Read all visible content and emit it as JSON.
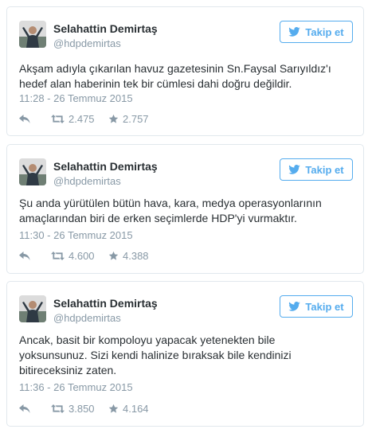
{
  "tweets": [
    {
      "name": "Selahattin Demirtaş",
      "handle": "@hdpdemirtas",
      "follow_label": "Takip et",
      "text": "Akşam adıyla çıkarılan havuz gazetesinin Sn.Faysal Sarıyıldız'ı\nhedef alan haberinin tek bir cümlesi dahi doğru değildir.",
      "timestamp": "11:28 - 26 Temmuz 2015",
      "retweets": "2.475",
      "favorites": "2.757"
    },
    {
      "name": "Selahattin Demirtaş",
      "handle": "@hdpdemirtas",
      "follow_label": "Takip et",
      "text": "Şu anda yürütülen bütün hava, kara, medya operasyonlarının\namaçlarından biri de erken seçimlerde HDP'yi vurmaktır.",
      "timestamp": "11:30 - 26 Temmuz 2015",
      "retweets": "4.600",
      "favorites": "4.388"
    },
    {
      "name": "Selahattin Demirtaş",
      "handle": "@hdpdemirtas",
      "follow_label": "Takip et",
      "text": "Ancak, basit bir kompoloyu yapacak  yetenekten bile\nyoksunsunuz. Sizi kendi halinize bıraksak bile kendinizi\nbitireceksiniz zaten.",
      "timestamp": "11:36 - 26 Temmuz 2015",
      "retweets": "3.850",
      "favorites": "4.164"
    }
  ],
  "icons": {
    "follow": "twitter-bird-icon",
    "reply": "reply-icon",
    "retweet": "retweet-icon",
    "favorite": "star-icon"
  },
  "colors": {
    "accent": "#55acee",
    "text": "#292f33",
    "muted": "#8899a6",
    "border": "#e1e8ed"
  }
}
